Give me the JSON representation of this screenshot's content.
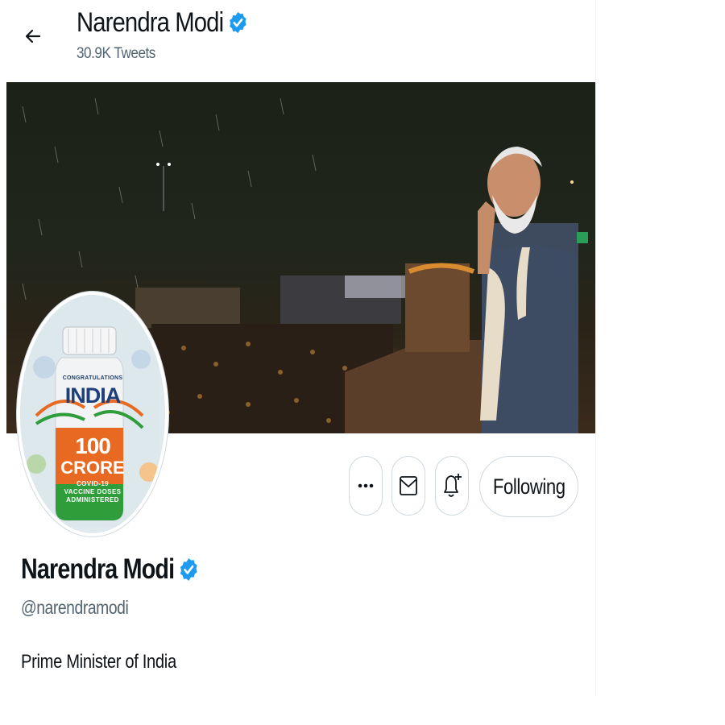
{
  "header": {
    "back_icon": "arrow-left-icon",
    "name": "Narendra Modi",
    "tweet_count": "30.9K Tweets"
  },
  "banner": {
    "description_icon": "banner-image"
  },
  "avatar": {
    "congrats": "CONGRATULATIONS",
    "country": "INDIA",
    "number": "100",
    "unit": "CRORE",
    "line1": "COVID-19",
    "line2": "VACCINE DOSES",
    "line3": "ADMINISTERED"
  },
  "actions": {
    "more_icon": "more-icon",
    "message_icon": "mail-icon",
    "notify_icon": "bell-plus-icon",
    "follow_label": "Following"
  },
  "profile": {
    "name": "Narendra Modi",
    "handle": "@narendramodi",
    "bio": "Prime Minister of India"
  },
  "colors": {
    "verified": "#1d9bf0",
    "text_primary": "#0f1419",
    "text_secondary": "#536471",
    "border": "#cfd9de",
    "saffron": "#e86a22",
    "green": "#2e9d3a"
  }
}
